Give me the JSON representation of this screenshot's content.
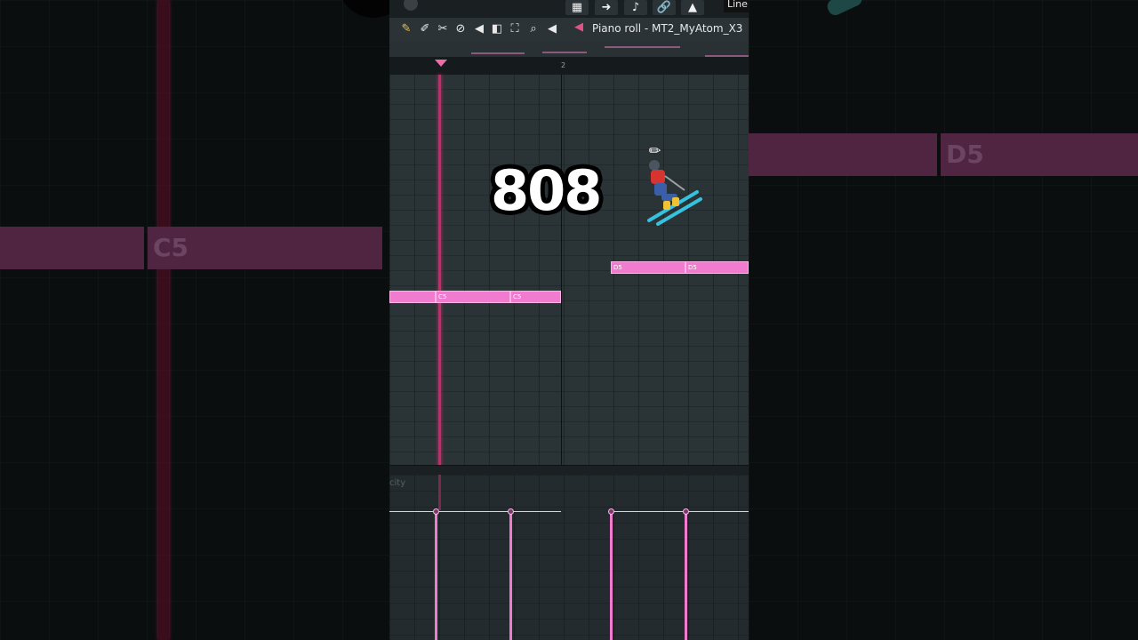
{
  "toolbar_top": {
    "snap_label": "Line",
    "buttons": [
      "grid-icon",
      "arrow-right-icon",
      "note-icon",
      "link-icon",
      "stamp-icon"
    ]
  },
  "toolbar_tools": {
    "tools": [
      "pencil-icon",
      "paint-brush-icon",
      "delete-icon",
      "mute-icon",
      "no-entry-icon",
      "slice-icon",
      "select-icon",
      "zoom-icon",
      "playback-icon"
    ],
    "title": "Piano roll - MT2_MyAtom_X3"
  },
  "ruler": {
    "bar_number": "2"
  },
  "notes": [
    {
      "label": ""
    },
    {
      "label": "C5"
    },
    {
      "label": "C5"
    },
    {
      "label": "D5"
    },
    {
      "label": "D5"
    }
  ],
  "side_notes": {
    "left": "C5",
    "right": "D5"
  },
  "velocity": {
    "label": "city"
  },
  "overlay": {
    "text": "808",
    "emoji_label": "skier"
  },
  "colors": {
    "note": "#f07bcf",
    "playhead": "#c62a6a",
    "accent": "#e0528a"
  }
}
